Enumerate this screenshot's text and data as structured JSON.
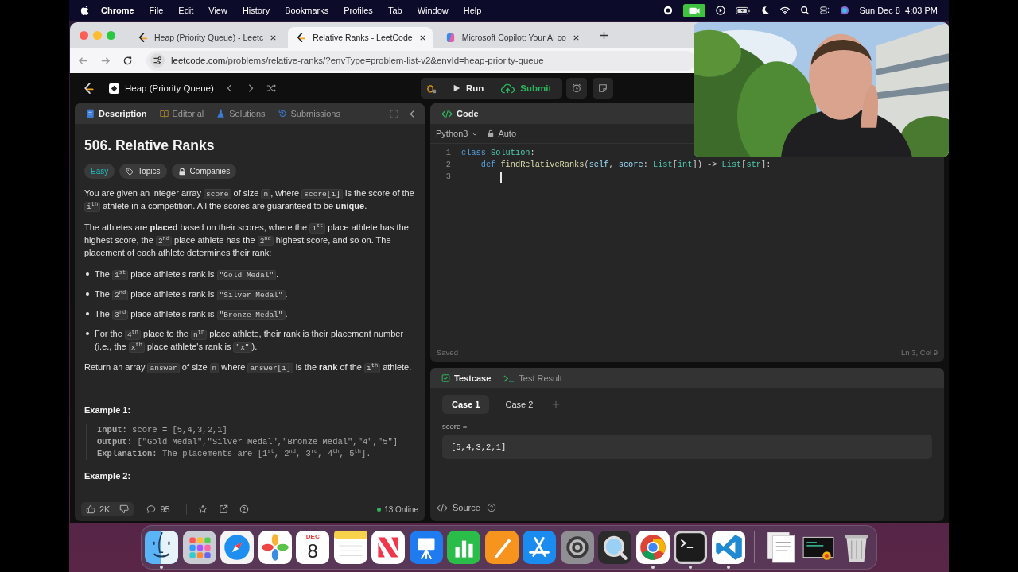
{
  "menu_bar": {
    "app": "Chrome",
    "menus": [
      "File",
      "Edit",
      "View",
      "History",
      "Bookmarks",
      "Profiles",
      "Tab",
      "Window",
      "Help"
    ],
    "clock": "Sun Dec 8  4:03 PM"
  },
  "browser": {
    "tabs": [
      {
        "title": "Heap (Priority Queue) - Leetc",
        "selected": false,
        "kind": "leetcode"
      },
      {
        "title": "Relative Ranks - LeetCode",
        "selected": true,
        "kind": "leetcode"
      },
      {
        "title": "Microsoft Copilot: Your AI co",
        "selected": false,
        "kind": "copilot"
      }
    ],
    "url": {
      "host": "leetcode.com",
      "path": "/problems/relative-ranks/?envType=problem-list-v2&envId=heap-priority-queue"
    }
  },
  "nav": {
    "problem_list": "Heap (Priority Queue)",
    "run": "Run",
    "submit": "Submit"
  },
  "description_panel": {
    "tabs": [
      {
        "label": "Description",
        "selected": true,
        "kind": "description"
      },
      {
        "label": "Editorial",
        "selected": false,
        "kind": "editorial"
      },
      {
        "label": "Solutions",
        "selected": false,
        "kind": "solutions"
      },
      {
        "label": "Submissions",
        "selected": false,
        "kind": "submissions"
      }
    ],
    "title": "506. Relative Ranks",
    "difficulty": "Easy",
    "tags": [
      {
        "label": "Topics",
        "kind": "topics"
      },
      {
        "label": "Companies",
        "kind": "companies"
      }
    ],
    "blocks": [
      {
        "kind": "paragraph",
        "segments": [
          {
            "text": "You are given an integer array "
          },
          {
            "code": "score"
          },
          {
            "text": " of size "
          },
          {
            "code": "n"
          },
          {
            "text": ", where "
          },
          {
            "code": "score[i]"
          },
          {
            "text": " is the score of the "
          },
          {
            "code": "i$^{th}$"
          },
          {
            "text": " athlete in a competition. All the scores are guaranteed to be **unique**."
          }
        ]
      },
      {
        "kind": "paragraph",
        "segments": [
          {
            "text": "The athletes are **placed** based on their scores, where the "
          },
          {
            "code": "1$^{st}$"
          },
          {
            "text": " place athlete has the highest score, the "
          },
          {
            "code": "2$^{nd}$"
          },
          {
            "text": " place athlete has the "
          },
          {
            "code": "2$^{nd}$"
          },
          {
            "text": " highest score, and so on. The placement of each athlete determines their rank:"
          }
        ]
      },
      {
        "kind": "bullets",
        "items": [
          [
            {
              "text": "The "
            },
            {
              "code": "1$^{st}$"
            },
            {
              "text": " place athlete's rank is "
            },
            {
              "code": "\"Gold Medal\""
            },
            {
              "text": "."
            }
          ],
          [
            {
              "text": "The "
            },
            {
              "code": "2$^{nd}$"
            },
            {
              "text": " place athlete's rank is "
            },
            {
              "code": "\"Silver Medal\""
            },
            {
              "text": "."
            }
          ],
          [
            {
              "text": "The "
            },
            {
              "code": "3$^{rd}$"
            },
            {
              "text": " place athlete's rank is "
            },
            {
              "code": "\"Bronze Medal\""
            },
            {
              "text": "."
            }
          ],
          [
            {
              "text": "For the "
            },
            {
              "code": "4$^{th}$"
            },
            {
              "text": " place to the "
            },
            {
              "code": "n$^{th}$"
            },
            {
              "text": " place athlete, their rank is their placement number (i.e., the "
            },
            {
              "code": "x$^{th}$"
            },
            {
              "text": " place athlete's rank is "
            },
            {
              "code": "\"x\""
            },
            {
              "text": ")."
            }
          ]
        ]
      },
      {
        "kind": "paragraph",
        "segments": [
          {
            "text": "Return an array "
          },
          {
            "code": "answer"
          },
          {
            "text": " of size "
          },
          {
            "code": "n"
          },
          {
            "text": " where "
          },
          {
            "code": "answer[i]"
          },
          {
            "text": " is the **rank** of the "
          },
          {
            "code": "i$^{th}$"
          },
          {
            "text": " athlete."
          }
        ]
      }
    ],
    "examples": [
      {
        "title": "Example 1:",
        "lines": [
          "**Input:** score = [5,4,3,2,1]",
          "**Output:** [\"Gold Medal\",\"Silver Medal\",\"Bronze Medal\",\"4\",\"5\"]",
          "**Explanation:** The placements are [1$^{st}$, 2$^{nd}$, 3$^{rd}$, 4$^{th}$, 5$^{th}$]."
        ]
      },
      {
        "title": "Example 2:"
      }
    ],
    "footer": {
      "likes": "2K",
      "comments": "95",
      "online": "13 Online"
    }
  },
  "editor": {
    "title": "Code",
    "language": "Python3",
    "mode": "Auto",
    "lines": [
      {
        "number": "1",
        "cursor": false,
        "tokens": [
          {
            "kind": "keyword",
            "text": "class "
          },
          {
            "kind": "type",
            "text": "Solution"
          },
          {
            "kind": "plain",
            "text": ":"
          }
        ]
      },
      {
        "number": "2",
        "cursor": false,
        "tokens": [
          {
            "kind": "keyword",
            "text": "    def "
          },
          {
            "kind": "function",
            "text": "findRelativeRanks"
          },
          {
            "kind": "plain",
            "text": "("
          },
          {
            "kind": "param",
            "text": "self"
          },
          {
            "kind": "plain",
            "text": ", "
          },
          {
            "kind": "param",
            "text": "score"
          },
          {
            "kind": "plain",
            "text": ": "
          },
          {
            "kind": "type",
            "text": "List"
          },
          {
            "kind": "plain",
            "text": "["
          },
          {
            "kind": "type",
            "text": "int"
          },
          {
            "kind": "plain",
            "text": "]) -> "
          },
          {
            "kind": "type",
            "text": "List"
          },
          {
            "kind": "plain",
            "text": "["
          },
          {
            "kind": "type",
            "text": "str"
          },
          {
            "kind": "plain",
            "text": "]:"
          }
        ]
      },
      {
        "number": "3",
        "cursor": true
      }
    ],
    "status": "Saved",
    "position": "Ln 3, Col 9"
  },
  "testcase_panel": {
    "tabs": [
      {
        "label": "Testcase",
        "selected": true,
        "kind": "testcase"
      },
      {
        "label": "Test Result",
        "selected": false,
        "kind": "result"
      }
    ],
    "cases": [
      {
        "label": "Case 1",
        "selected": true
      },
      {
        "label": "Case 2",
        "selected": false
      }
    ],
    "param_label": "score =",
    "param_value": "[5,4,3,2,1]",
    "source": "Source"
  },
  "dock": {
    "calendar_month": "DEC",
    "calendar_day": "8",
    "items": [
      {
        "running": true
      },
      {
        "running": false
      },
      {
        "running": false
      },
      {
        "running": false
      },
      {
        "running": false
      },
      {
        "running": false
      },
      {
        "running": false
      },
      {
        "running": false
      },
      {
        "running": false
      },
      {
        "running": false
      },
      {
        "running": false
      },
      {
        "running": false
      },
      {
        "running": false
      },
      {
        "running": true
      },
      {
        "running": true
      },
      {
        "running": true
      },
      {
        "running": false
      },
      {
        "running": false
      },
      {
        "running": false
      }
    ]
  }
}
